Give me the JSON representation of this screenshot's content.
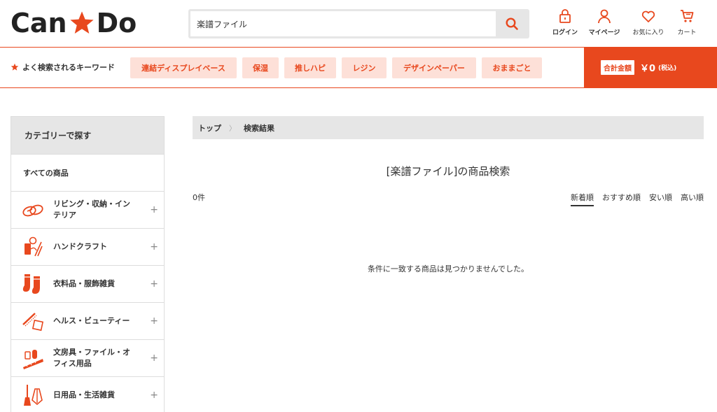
{
  "header": {
    "logo_left": "Can",
    "logo_right": "Do",
    "search_value": "楽譜ファイル",
    "nav": {
      "login": "ログイン",
      "mypage": "マイページ",
      "favorites": "お気に入り",
      "cart": "カート"
    }
  },
  "keywords": {
    "label": "よく検索されるキーワード",
    "items": [
      "連結ディスプレイベース",
      "保湿",
      "推しハピ",
      "レジン",
      "デザインペーパー",
      "おままごと"
    ]
  },
  "cart_total": {
    "label": "合計金額",
    "value": "￥0",
    "tax": "(税込)"
  },
  "sidebar": {
    "title": "カテゴリーで探す",
    "all_items": "すべての商品",
    "categories": [
      {
        "label": "リビング・収納・インテリア",
        "icon": "living-icon"
      },
      {
        "label": "ハンドクラフト",
        "icon": "handcraft-icon"
      },
      {
        "label": "衣料品・服飾雑貨",
        "icon": "clothing-icon"
      },
      {
        "label": "ヘルス・ビューティー",
        "icon": "beauty-icon"
      },
      {
        "label": "文房具・ファイル・オフィス用品",
        "icon": "stationery-icon"
      },
      {
        "label": "日用品・生活雑貨",
        "icon": "daily-goods-icon"
      }
    ]
  },
  "breadcrumb": {
    "top": "トップ",
    "separator": "〉",
    "current": "検索結果"
  },
  "main": {
    "title": "[楽譜ファイル]の商品検索",
    "count": "0件",
    "sorts": [
      "新着順",
      "おすすめ順",
      "安い順",
      "高い順"
    ],
    "empty_message": "条件に一致する商品は見つかりませんでした。"
  },
  "colors": {
    "accent": "#e8481e",
    "keyword_bg": "#fde0d8",
    "panel_gray": "#e6e6e6"
  }
}
